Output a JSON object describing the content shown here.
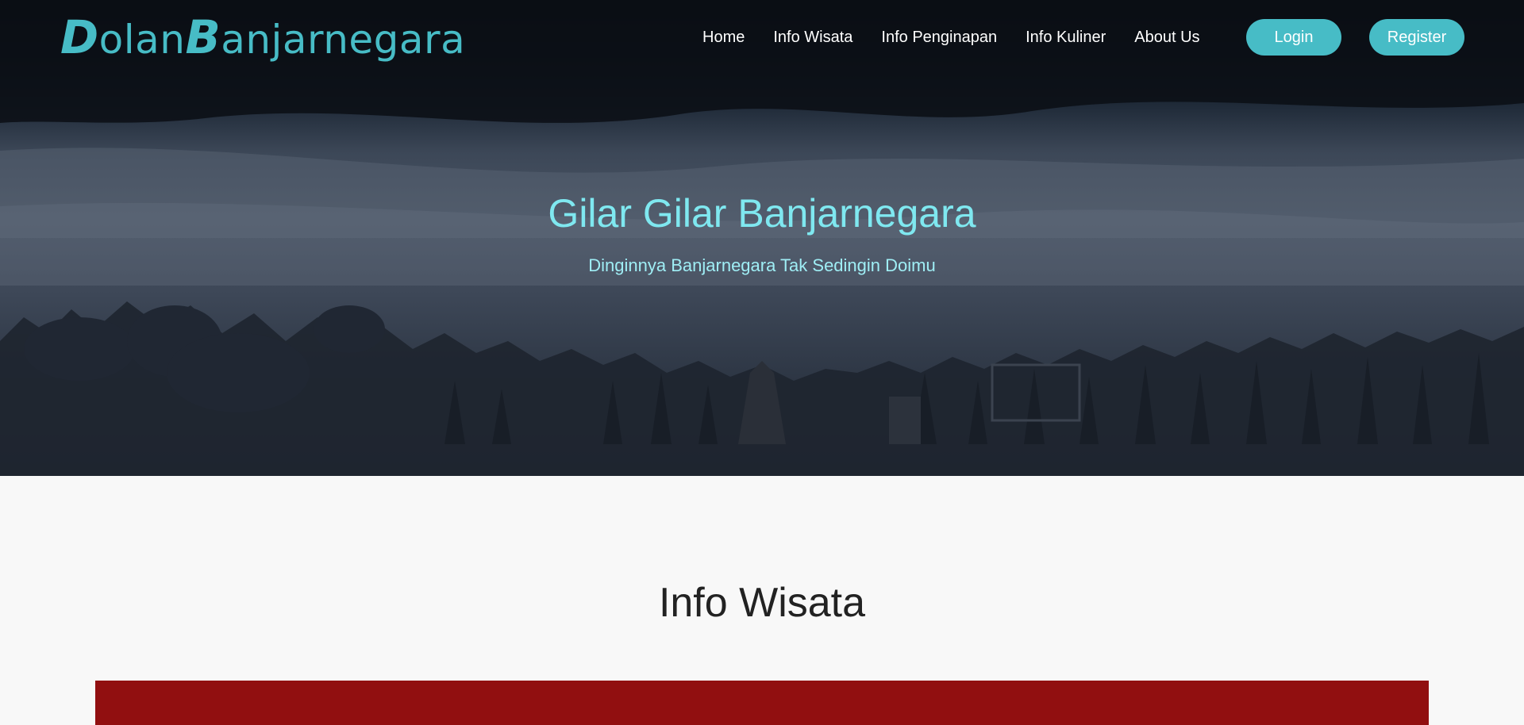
{
  "brand": {
    "name_first_initial": "D",
    "name_first_rest": "olan",
    "name_second_initial": "B",
    "name_second_rest": "anjarnegara"
  },
  "nav": {
    "links": [
      {
        "label": "Home"
      },
      {
        "label": "Info Wisata"
      },
      {
        "label": "Info Penginapan"
      },
      {
        "label": "Info Kuliner"
      },
      {
        "label": "About Us"
      }
    ],
    "login_label": "Login",
    "register_label": "Register"
  },
  "hero": {
    "title": "Gilar Gilar Banjarnegara",
    "subtitle": "Dinginnya Banjarnegara Tak Sedingin Doimu"
  },
  "section": {
    "title": "Info Wisata"
  },
  "colors": {
    "accent": "#47bcc6",
    "hero_title": "#7fe8f0",
    "card": "#910f10",
    "page_bg": "#f8f8f8"
  }
}
